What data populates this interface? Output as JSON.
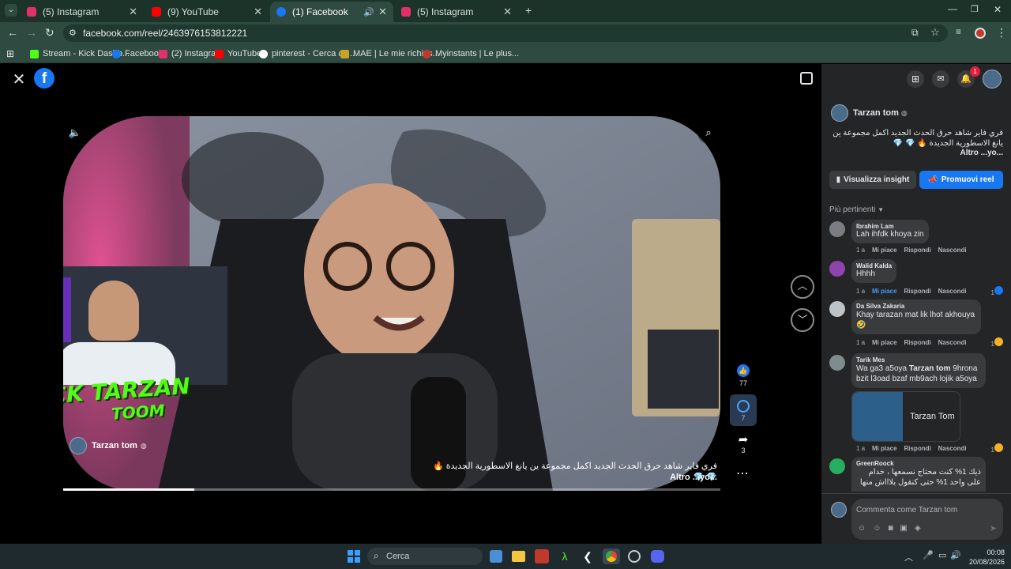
{
  "browser": {
    "tabs": [
      {
        "label": "(5) Instagram",
        "color": "#e1306c"
      },
      {
        "label": "(9) YouTube",
        "color": "#ff0000"
      },
      {
        "label": "(1) Facebook",
        "color": "#1877f2"
      },
      {
        "label": "(5) Instagram",
        "color": "#e1306c"
      }
    ],
    "url": "facebook.com/reel/2463976153812221",
    "bookmarks": [
      {
        "label": "Stream - Kick Dashb...",
        "color": "#53fc18"
      },
      {
        "label": "Facebook",
        "color": "#1877f2"
      },
      {
        "label": "(2) Instagram",
        "color": "#e1306c"
      },
      {
        "label": "YouTube",
        "color": "#ff0000"
      },
      {
        "label": "pinterest - Cerca co...",
        "color": "#ffffff"
      },
      {
        "label": "MAE | Le mie richies...",
        "color": "#c9a227"
      },
      {
        "label": "Myinstants | Le plus...",
        "color": "#c0392b"
      }
    ]
  },
  "reel": {
    "author": "Tarzan tom",
    "caption_line1": "فري فاير شاهد حرق الحدث الجديد اكمل مجموعة ين يانغ الاسطورية الجديدة 🔥 💎 💎",
    "caption_more": "Altro ...yo...",
    "likes": "77",
    "comments": "7",
    "shares": "3",
    "overlay_brand": "KICK TARZAN",
    "overlay_brand2": "TOOM",
    "progress": 0.2
  },
  "sidebar": {
    "notif_count": "1",
    "author": "Tarzan tom",
    "caption_line1": "فري فاير شاهد حرق الحدث الجديد اكمل مجموعة ين",
    "caption_line2": "يانغ الاسطورية الجديدة 🔥 💎 💎",
    "caption_more": "Altro ...yo...",
    "insight_label": "Visualizza insight",
    "promote_label": "Promuovi reel",
    "filter_label": "Più pertinenti",
    "comments": [
      {
        "name": "Ibrahim Lam",
        "text": "Lah ihfdk khoya zin",
        "time": "1 a",
        "like": "Mi piace",
        "reply": "Rispondi",
        "hide": "Nascondi",
        "count": "",
        "liked": false
      },
      {
        "name": "Walid Kalda",
        "text": "Hhhh",
        "time": "1 a",
        "like": "Mi piace",
        "reply": "Rispondi",
        "hide": "Nascondi",
        "count": "1",
        "liked": true
      },
      {
        "name": "Da Silva Zakaria",
        "text": "Khay tarazan mat lik lhot akhouya 🤣",
        "time": "1 a",
        "like": "Mi piace",
        "reply": "Rispondi",
        "hide": "Nascondi",
        "count": "1",
        "liked": false
      },
      {
        "name": "Tarik Mes",
        "text_pre": "Wa ga3 a5oya ",
        "text_bold": "Tarzan tom",
        "text_post": " 9hrona bzit l3oad bzaf mb9ach lojik a5oya",
        "time": "1 a",
        "like": "Mi piace",
        "reply": "Rispondi",
        "hide": "Nascondi",
        "count": "1",
        "liked": false,
        "tag": "Tarzan Tom"
      },
      {
        "name": "GreenRoock",
        "text": "ذيك 1% كنت محتاج نسمعها ، خدام على واحد 1% حتى كنقول بلاااش منها",
        "time": "",
        "like": "",
        "reply": "",
        "hide": "",
        "count": "",
        "liked": false
      }
    ],
    "comment_placeholder": "Commenta come Tarzan tom"
  },
  "taskbar": {
    "search_label": "Cerca",
    "time": "00:08",
    "date": "20/08/2026"
  }
}
